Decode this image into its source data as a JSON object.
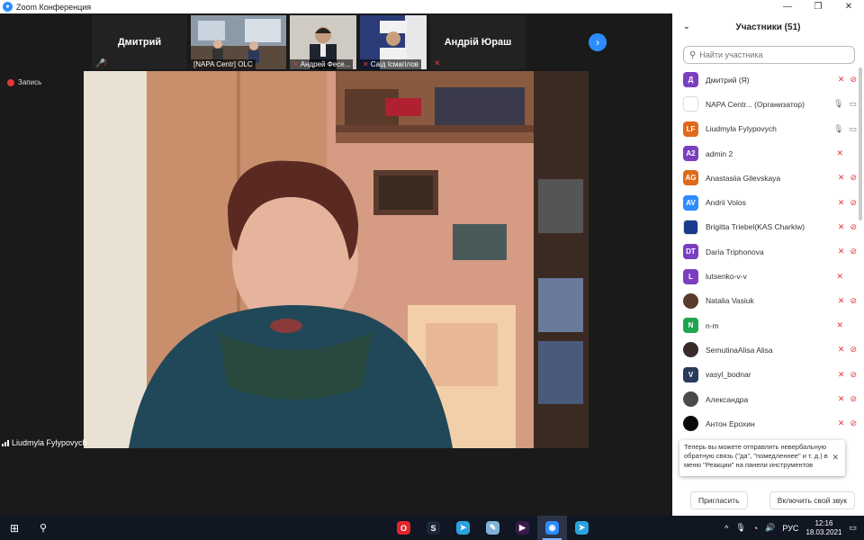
{
  "window": {
    "title": "Zoom Конференция",
    "controls": [
      "—",
      "❐",
      "✕"
    ]
  },
  "video_strip": {
    "tiles": [
      {
        "name": "Дмитрий",
        "type": "name",
        "muted": true
      },
      {
        "name": "[NAPA Centr] OLC",
        "type": "video",
        "muted": false
      },
      {
        "name": "Андрей Фесе...",
        "type": "video",
        "muted": true
      },
      {
        "name": "Саід Ісмагілов",
        "type": "video",
        "muted": true
      },
      {
        "name": "Андрій Юраш",
        "type": "name",
        "muted": true
      }
    ],
    "next_icon": "›"
  },
  "recording": {
    "label": "Запись"
  },
  "active_speaker": {
    "name": "Liudmyla Fylypovych"
  },
  "participants_panel": {
    "title": "Участники (51)",
    "collapse_icon": "⌄",
    "search_placeholder": "Найти участника",
    "participants": [
      {
        "initials": "Д",
        "color": "#7b3fbf",
        "name": "Дмитрий (Я)",
        "mic": "off",
        "cam": "off"
      },
      {
        "initials": "",
        "color": "#ffffff",
        "name": "NAPA Centr...  (Организатор)",
        "mic": "on",
        "cam": "on",
        "logo": true
      },
      {
        "initials": "LF",
        "color": "#e06a1b",
        "name": "Liudmyla Fylypovych",
        "mic": "on",
        "cam": "on"
      },
      {
        "initials": "A2",
        "color": "#7b3fbf",
        "name": "admin 2",
        "mic": "off",
        "cam": "none"
      },
      {
        "initials": "AG",
        "color": "#e06a1b",
        "name": "Anastasiia Gilevskaya",
        "mic": "off",
        "cam": "off"
      },
      {
        "initials": "AV",
        "color": "#2d8cff",
        "name": "Andrii Volos",
        "mic": "off",
        "cam": "off"
      },
      {
        "initials": "",
        "color": "#1b3a8c",
        "name": "Brigitta Triebel(KAS Charkiw)",
        "mic": "off",
        "cam": "off",
        "logo": true
      },
      {
        "initials": "DT",
        "color": "#7b3fbf",
        "name": "Daria Triphonova",
        "mic": "off",
        "cam": "off"
      },
      {
        "initials": "L",
        "color": "#7b3fbf",
        "name": "lutsenko-v-v",
        "mic": "off",
        "cam": "none"
      },
      {
        "initials": "",
        "color": "#5a3a2a",
        "name": "Natalia Vasiuk",
        "mic": "off",
        "cam": "off",
        "photo": true
      },
      {
        "initials": "N",
        "color": "#1fa550",
        "name": "n-m",
        "mic": "off",
        "cam": "none"
      },
      {
        "initials": "",
        "color": "#3a2a2a",
        "name": "SemutinaAlisa Alisa",
        "mic": "off",
        "cam": "off",
        "photo": true
      },
      {
        "initials": "V",
        "color": "#2a3a5a",
        "name": "vasyl_bodnar",
        "mic": "off",
        "cam": "off"
      },
      {
        "initials": "",
        "color": "#4a4a4a",
        "name": "Александра",
        "mic": "off",
        "cam": "off",
        "photo": true
      },
      {
        "initials": "",
        "color": "#0a0a0a",
        "name": "Антон Ерохин",
        "mic": "off",
        "cam": "off",
        "photo": true
      }
    ],
    "toast": {
      "text": "Теперь вы можете отправлять невербальную обратную связь (\"да\", \"помедленнее\" и т. д.) в меню \"Реакции\" на панели инструментов",
      "close": "✕"
    },
    "footer": {
      "invite": "Пригласить",
      "unmute_self": "Включить свой звук"
    }
  },
  "taskbar": {
    "start_icon": "⊞",
    "search_icon": "⚲",
    "apps": [
      {
        "name": "opera",
        "glyph": "O",
        "color": "#e0242b"
      },
      {
        "name": "steam",
        "glyph": "S",
        "color": "#1b2838"
      },
      {
        "name": "telegram",
        "glyph": "➤",
        "color": "#2aa3df"
      },
      {
        "name": "notes",
        "glyph": "✎",
        "color": "#7fb3d9"
      },
      {
        "name": "media",
        "glyph": "▶",
        "color": "#3a1a4a"
      },
      {
        "name": "zoom",
        "glyph": "◉",
        "color": "#2d8cff",
        "active": true
      },
      {
        "name": "telegram-2",
        "glyph": "➤",
        "color": "#2aa3df"
      }
    ],
    "tray": {
      "lang": "РУС",
      "time": "12:16",
      "date": "18.03.2021"
    }
  }
}
